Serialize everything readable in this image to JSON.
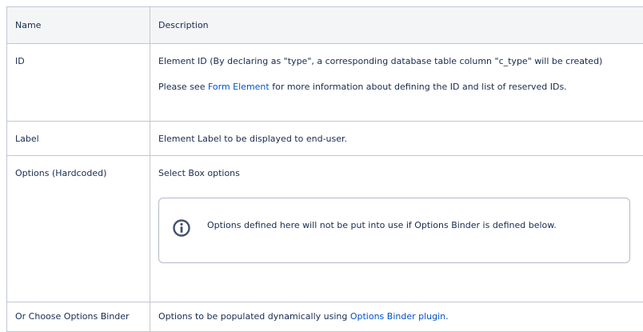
{
  "table": {
    "headers": {
      "name": "Name",
      "description": "Description"
    },
    "rows": {
      "id": {
        "name": "ID",
        "desc_line1": "Element ID (By declaring as \"type\", a corresponding database table column \"c_type\" will be created)",
        "desc_line2_prefix": "Please see ",
        "desc_line2_link": "Form Element",
        "desc_line2_suffix": " for more information about defining the ID and list of reserved IDs."
      },
      "label": {
        "name": "Label",
        "desc": "Element Label to be displayed to end-user."
      },
      "options": {
        "name": "Options (Hardcoded)",
        "desc": "Select Box options",
        "info_icon": "info-icon",
        "info_text": "Options defined here will not be put into use if Options Binder is defined below."
      },
      "binder": {
        "name": "Or Choose Options Binder",
        "desc_prefix": "Options to be populated dynamically using ",
        "desc_link": "Options Binder plugin",
        "desc_suffix": "."
      }
    }
  },
  "colors": {
    "link": "#0052cc",
    "header_bg": "#f4f5f7",
    "border": "#c1c7d0",
    "text": "#172b4d"
  }
}
